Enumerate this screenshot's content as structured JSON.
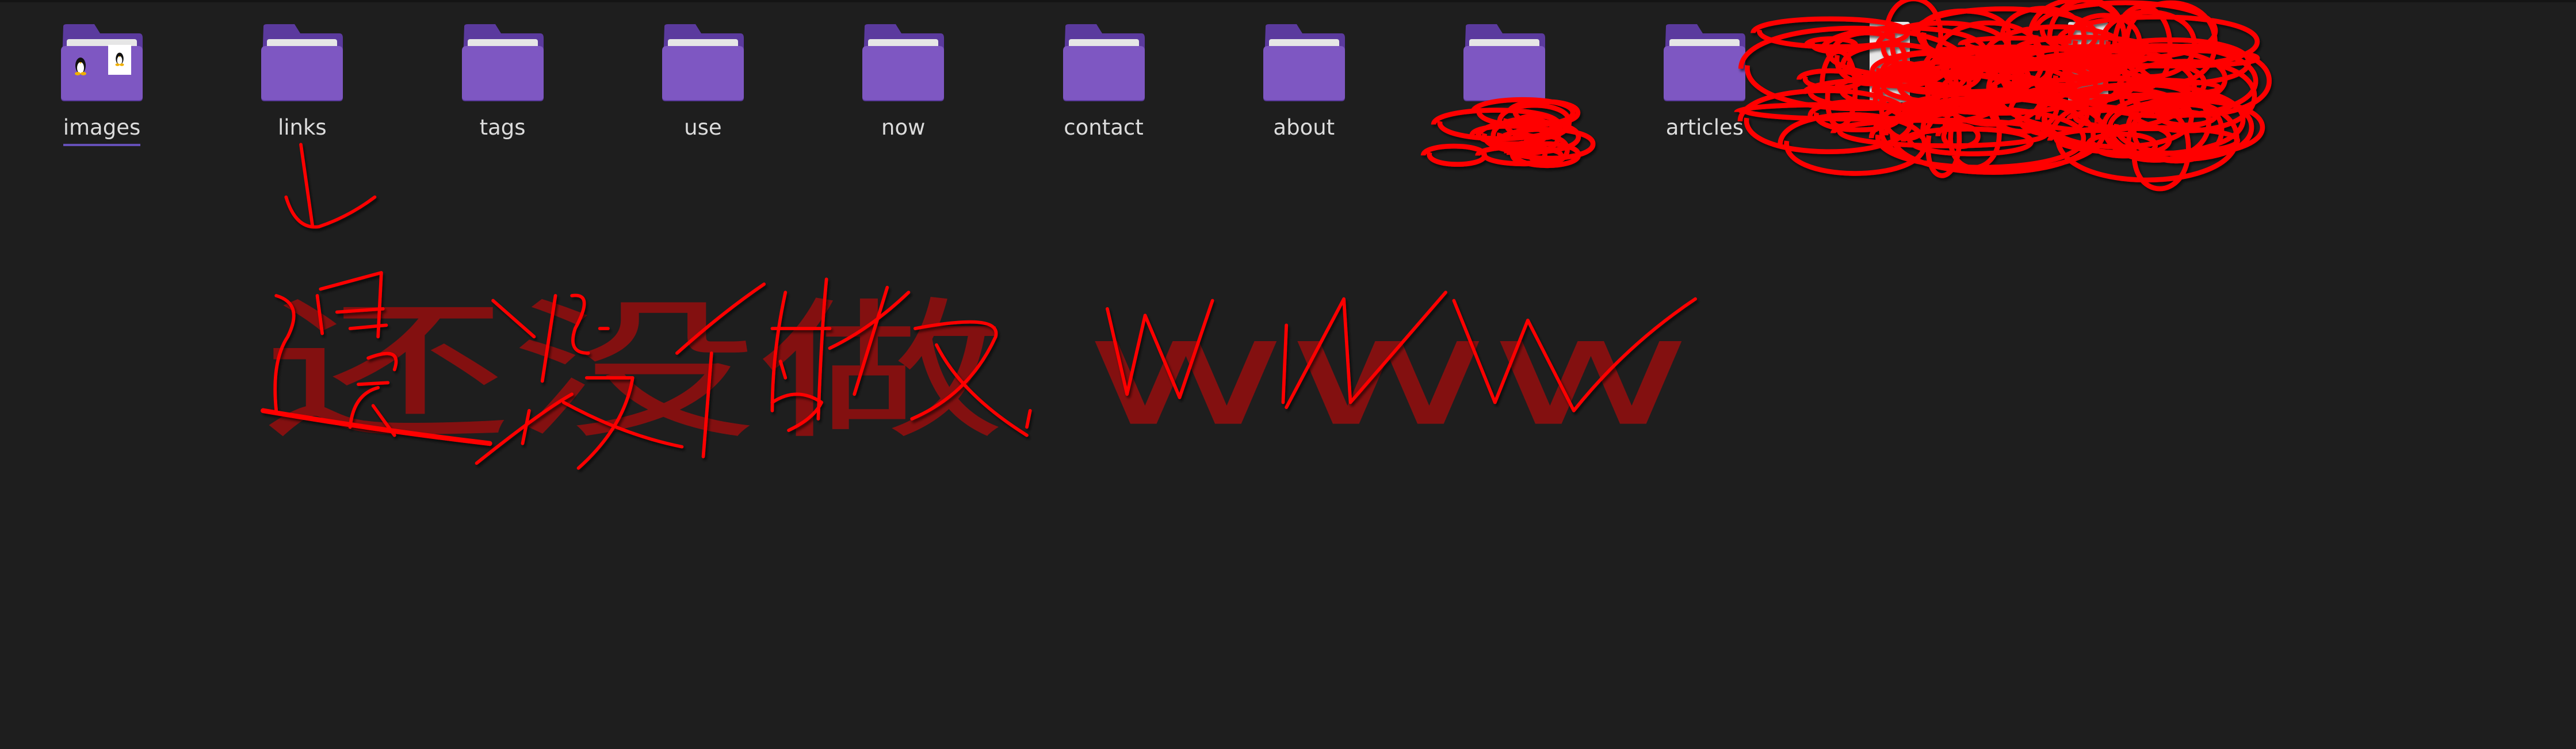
{
  "folders": [
    {
      "name": "images",
      "selected": true,
      "thumbnails": [
        "tux-penguin",
        "tux-penguin"
      ]
    },
    {
      "name": "links"
    },
    {
      "name": "tags"
    },
    {
      "name": "use"
    },
    {
      "name": "now"
    },
    {
      "name": "contact"
    },
    {
      "name": "about"
    },
    {
      "name": ""
    },
    {
      "name": "articles"
    }
  ],
  "files": [
    {
      "name": ""
    },
    {
      "name": ""
    }
  ],
  "annotation": {
    "handwritten_text": "还没做 www",
    "color": "#ff0000"
  },
  "colors": {
    "background": "#1e1e1e",
    "folder": "#7e57c2",
    "folder_back": "#5b3a9e",
    "accent": "#6550b8"
  }
}
